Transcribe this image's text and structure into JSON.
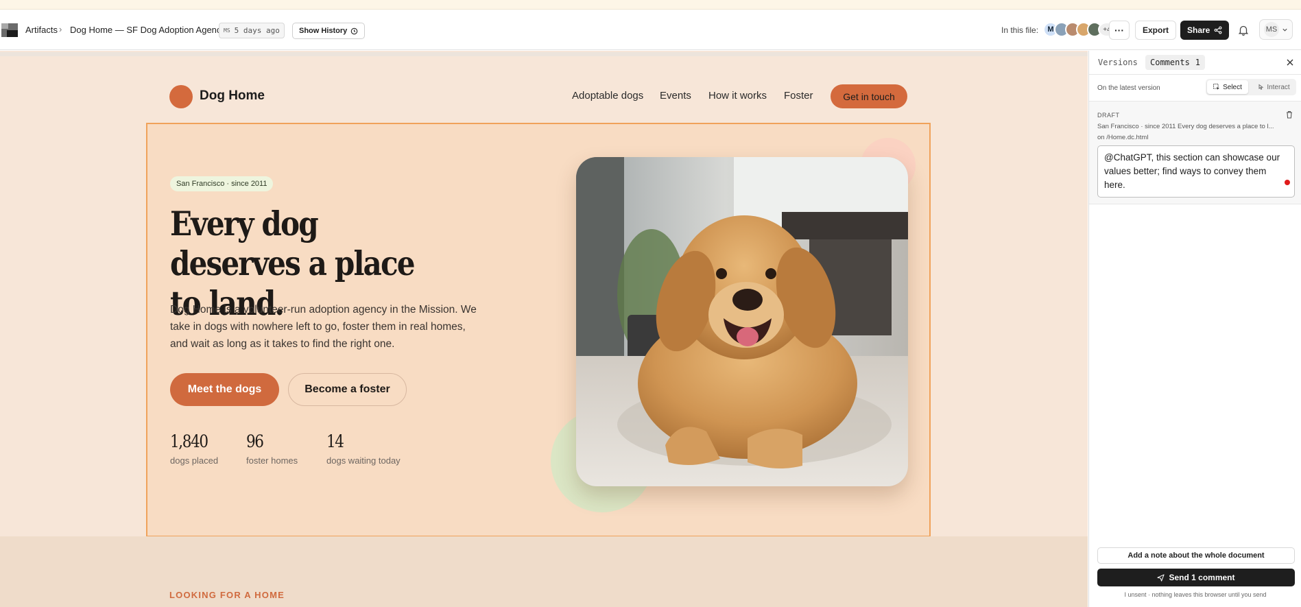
{
  "header": {
    "breadcrumb_root": "Artifacts",
    "breadcrumb_sep": "›",
    "document_title": "Dog Home — SF Dog Adoption Agency",
    "editor_initials": "MS",
    "edited_ago": "5 days ago",
    "show_history_label": "Show History",
    "in_file_label": "In this file:",
    "collaborator_initial": "M",
    "collaborators_more": "+4",
    "more_label": "···",
    "export_label": "Export",
    "share_label": "Share",
    "user_initials": "MS"
  },
  "site": {
    "brand": "Dog Home",
    "nav": [
      "Adoptable dogs",
      "Events",
      "How it works",
      "Foster"
    ],
    "cta": "Get in touch",
    "hero": {
      "badge": "San Francisco · since 2011",
      "title": "Every dog deserves a place to land.",
      "copy": "Dog Home is a volunteer-run adoption agency in the Mission. We take in dogs with nowhere left to go, foster them in real homes, and wait as long as it takes to find the right one.",
      "primary_cta": "Meet the dogs",
      "secondary_cta": "Become a foster",
      "stats": [
        {
          "value": "1,840",
          "label": "dogs placed"
        },
        {
          "value": "96",
          "label": "foster homes"
        },
        {
          "value": "14",
          "label": "dogs waiting today"
        }
      ]
    },
    "next_section_eyebrow": "LOOKING FOR A HOME"
  },
  "panel": {
    "tab_versions": "Versions",
    "tab_comments": "Comments",
    "comments_count": "1",
    "version_status": "On the latest version",
    "mode_select": "Select",
    "mode_interact": "Interact",
    "draft_label": "DRAFT",
    "draft_context": "San Francisco · since 2011 Every dog deserves a place to l...",
    "draft_location": "on /Home.dc.html",
    "comment_text": "@ChatGPT, this section can showcase our values better; find ways to convey them here.",
    "note_button": "Add a note about the whole document",
    "send_button": "Send 1 comment",
    "footnote": "I unsent · nothing leaves this browser until you send"
  },
  "colors": {
    "accent": "#d46a3d",
    "hero_bg": "#f8dcc3",
    "page_bg": "#f7e6d8",
    "selection_outline": "#f0a25a"
  }
}
